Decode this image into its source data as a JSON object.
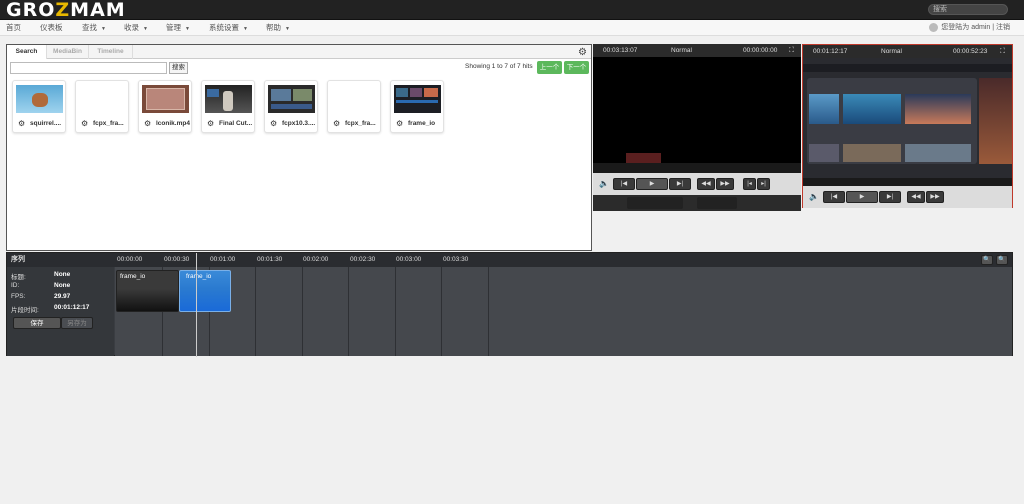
{
  "header": {
    "logo_pre": "GRO",
    "logo_accent": "Z",
    "logo_post": "MAM",
    "search_placeholder": "搜索",
    "user_text": "您登陆为 admin | 注销"
  },
  "nav": [
    {
      "label": "首页",
      "caret": ""
    },
    {
      "label": "仪表板",
      "caret": ""
    },
    {
      "label": "查找",
      "caret": "▼"
    },
    {
      "label": "收录",
      "caret": "▼"
    },
    {
      "label": "管理",
      "caret": "▼"
    },
    {
      "label": "系统设置",
      "caret": "▼"
    },
    {
      "label": "帮助",
      "caret": "▼"
    }
  ],
  "search_panel": {
    "tabs": [
      "Search",
      "MediaBin",
      "Timeline"
    ],
    "active_tab": "Search",
    "search_button": "搜索",
    "hits_text": "Showing 1 to 7 of 7 hits",
    "prev_button": "上一个",
    "next_button": "下一个",
    "results": [
      {
        "name": "squirrel....",
        "thumb": "squirrel"
      },
      {
        "name": "fcpx_fra...",
        "thumb": "blank"
      },
      {
        "name": "lconik.mp4",
        "thumb": "frame"
      },
      {
        "name": "Final Cut...",
        "thumb": "studio"
      },
      {
        "name": "fcpx10.3....",
        "thumb": "editor"
      },
      {
        "name": "fcpx_fra...",
        "thumb": "blank"
      },
      {
        "name": "frame_io",
        "thumb": "ui"
      }
    ]
  },
  "viewer_left": {
    "timecode_left": "00:03:13:07",
    "mode": "Normal",
    "timecode_right": "00:00:00:00"
  },
  "viewer_right": {
    "timecode_left": "00:01:12:17",
    "mode": "Normal",
    "timecode_right": "00:00:52:23"
  },
  "timeline": {
    "title": "序列",
    "ruler": [
      "00:00:00",
      "00:00:30",
      "00:01:00",
      "00:01:30",
      "00:02:00",
      "00:02:30",
      "00:03:00",
      "00:03:30"
    ],
    "info": [
      {
        "label": "标题:",
        "value": "None"
      },
      {
        "label": "ID:",
        "value": "None"
      },
      {
        "label": "FPS:",
        "value": "29.97"
      },
      {
        "label": "片段时间:",
        "value": "00:01:12:17"
      }
    ],
    "save_button": "保存",
    "saveas_button": "另存为",
    "clips": [
      {
        "label": "frame_io"
      },
      {
        "label": "frame_io"
      }
    ]
  }
}
